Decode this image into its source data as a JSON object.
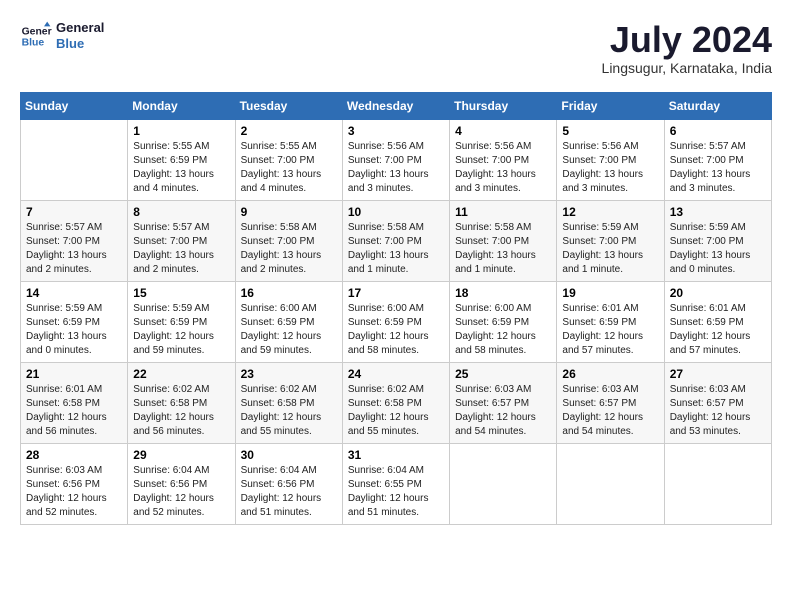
{
  "header": {
    "logo_line1": "General",
    "logo_line2": "Blue",
    "month_title": "July 2024",
    "location": "Lingsugur, Karnataka, India"
  },
  "weekdays": [
    "Sunday",
    "Monday",
    "Tuesday",
    "Wednesday",
    "Thursday",
    "Friday",
    "Saturday"
  ],
  "weeks": [
    [
      {
        "day": "",
        "info": ""
      },
      {
        "day": "1",
        "info": "Sunrise: 5:55 AM\nSunset: 6:59 PM\nDaylight: 13 hours\nand 4 minutes."
      },
      {
        "day": "2",
        "info": "Sunrise: 5:55 AM\nSunset: 7:00 PM\nDaylight: 13 hours\nand 4 minutes."
      },
      {
        "day": "3",
        "info": "Sunrise: 5:56 AM\nSunset: 7:00 PM\nDaylight: 13 hours\nand 3 minutes."
      },
      {
        "day": "4",
        "info": "Sunrise: 5:56 AM\nSunset: 7:00 PM\nDaylight: 13 hours\nand 3 minutes."
      },
      {
        "day": "5",
        "info": "Sunrise: 5:56 AM\nSunset: 7:00 PM\nDaylight: 13 hours\nand 3 minutes."
      },
      {
        "day": "6",
        "info": "Sunrise: 5:57 AM\nSunset: 7:00 PM\nDaylight: 13 hours\nand 3 minutes."
      }
    ],
    [
      {
        "day": "7",
        "info": "Sunrise: 5:57 AM\nSunset: 7:00 PM\nDaylight: 13 hours\nand 2 minutes."
      },
      {
        "day": "8",
        "info": "Sunrise: 5:57 AM\nSunset: 7:00 PM\nDaylight: 13 hours\nand 2 minutes."
      },
      {
        "day": "9",
        "info": "Sunrise: 5:58 AM\nSunset: 7:00 PM\nDaylight: 13 hours\nand 2 minutes."
      },
      {
        "day": "10",
        "info": "Sunrise: 5:58 AM\nSunset: 7:00 PM\nDaylight: 13 hours\nand 1 minute."
      },
      {
        "day": "11",
        "info": "Sunrise: 5:58 AM\nSunset: 7:00 PM\nDaylight: 13 hours\nand 1 minute."
      },
      {
        "day": "12",
        "info": "Sunrise: 5:59 AM\nSunset: 7:00 PM\nDaylight: 13 hours\nand 1 minute."
      },
      {
        "day": "13",
        "info": "Sunrise: 5:59 AM\nSunset: 7:00 PM\nDaylight: 13 hours\nand 0 minutes."
      }
    ],
    [
      {
        "day": "14",
        "info": "Sunrise: 5:59 AM\nSunset: 6:59 PM\nDaylight: 13 hours\nand 0 minutes."
      },
      {
        "day": "15",
        "info": "Sunrise: 5:59 AM\nSunset: 6:59 PM\nDaylight: 12 hours\nand 59 minutes."
      },
      {
        "day": "16",
        "info": "Sunrise: 6:00 AM\nSunset: 6:59 PM\nDaylight: 12 hours\nand 59 minutes."
      },
      {
        "day": "17",
        "info": "Sunrise: 6:00 AM\nSunset: 6:59 PM\nDaylight: 12 hours\nand 58 minutes."
      },
      {
        "day": "18",
        "info": "Sunrise: 6:00 AM\nSunset: 6:59 PM\nDaylight: 12 hours\nand 58 minutes."
      },
      {
        "day": "19",
        "info": "Sunrise: 6:01 AM\nSunset: 6:59 PM\nDaylight: 12 hours\nand 57 minutes."
      },
      {
        "day": "20",
        "info": "Sunrise: 6:01 AM\nSunset: 6:59 PM\nDaylight: 12 hours\nand 57 minutes."
      }
    ],
    [
      {
        "day": "21",
        "info": "Sunrise: 6:01 AM\nSunset: 6:58 PM\nDaylight: 12 hours\nand 56 minutes."
      },
      {
        "day": "22",
        "info": "Sunrise: 6:02 AM\nSunset: 6:58 PM\nDaylight: 12 hours\nand 56 minutes."
      },
      {
        "day": "23",
        "info": "Sunrise: 6:02 AM\nSunset: 6:58 PM\nDaylight: 12 hours\nand 55 minutes."
      },
      {
        "day": "24",
        "info": "Sunrise: 6:02 AM\nSunset: 6:58 PM\nDaylight: 12 hours\nand 55 minutes."
      },
      {
        "day": "25",
        "info": "Sunrise: 6:03 AM\nSunset: 6:57 PM\nDaylight: 12 hours\nand 54 minutes."
      },
      {
        "day": "26",
        "info": "Sunrise: 6:03 AM\nSunset: 6:57 PM\nDaylight: 12 hours\nand 54 minutes."
      },
      {
        "day": "27",
        "info": "Sunrise: 6:03 AM\nSunset: 6:57 PM\nDaylight: 12 hours\nand 53 minutes."
      }
    ],
    [
      {
        "day": "28",
        "info": "Sunrise: 6:03 AM\nSunset: 6:56 PM\nDaylight: 12 hours\nand 52 minutes."
      },
      {
        "day": "29",
        "info": "Sunrise: 6:04 AM\nSunset: 6:56 PM\nDaylight: 12 hours\nand 52 minutes."
      },
      {
        "day": "30",
        "info": "Sunrise: 6:04 AM\nSunset: 6:56 PM\nDaylight: 12 hours\nand 51 minutes."
      },
      {
        "day": "31",
        "info": "Sunrise: 6:04 AM\nSunset: 6:55 PM\nDaylight: 12 hours\nand 51 minutes."
      },
      {
        "day": "",
        "info": ""
      },
      {
        "day": "",
        "info": ""
      },
      {
        "day": "",
        "info": ""
      }
    ]
  ]
}
